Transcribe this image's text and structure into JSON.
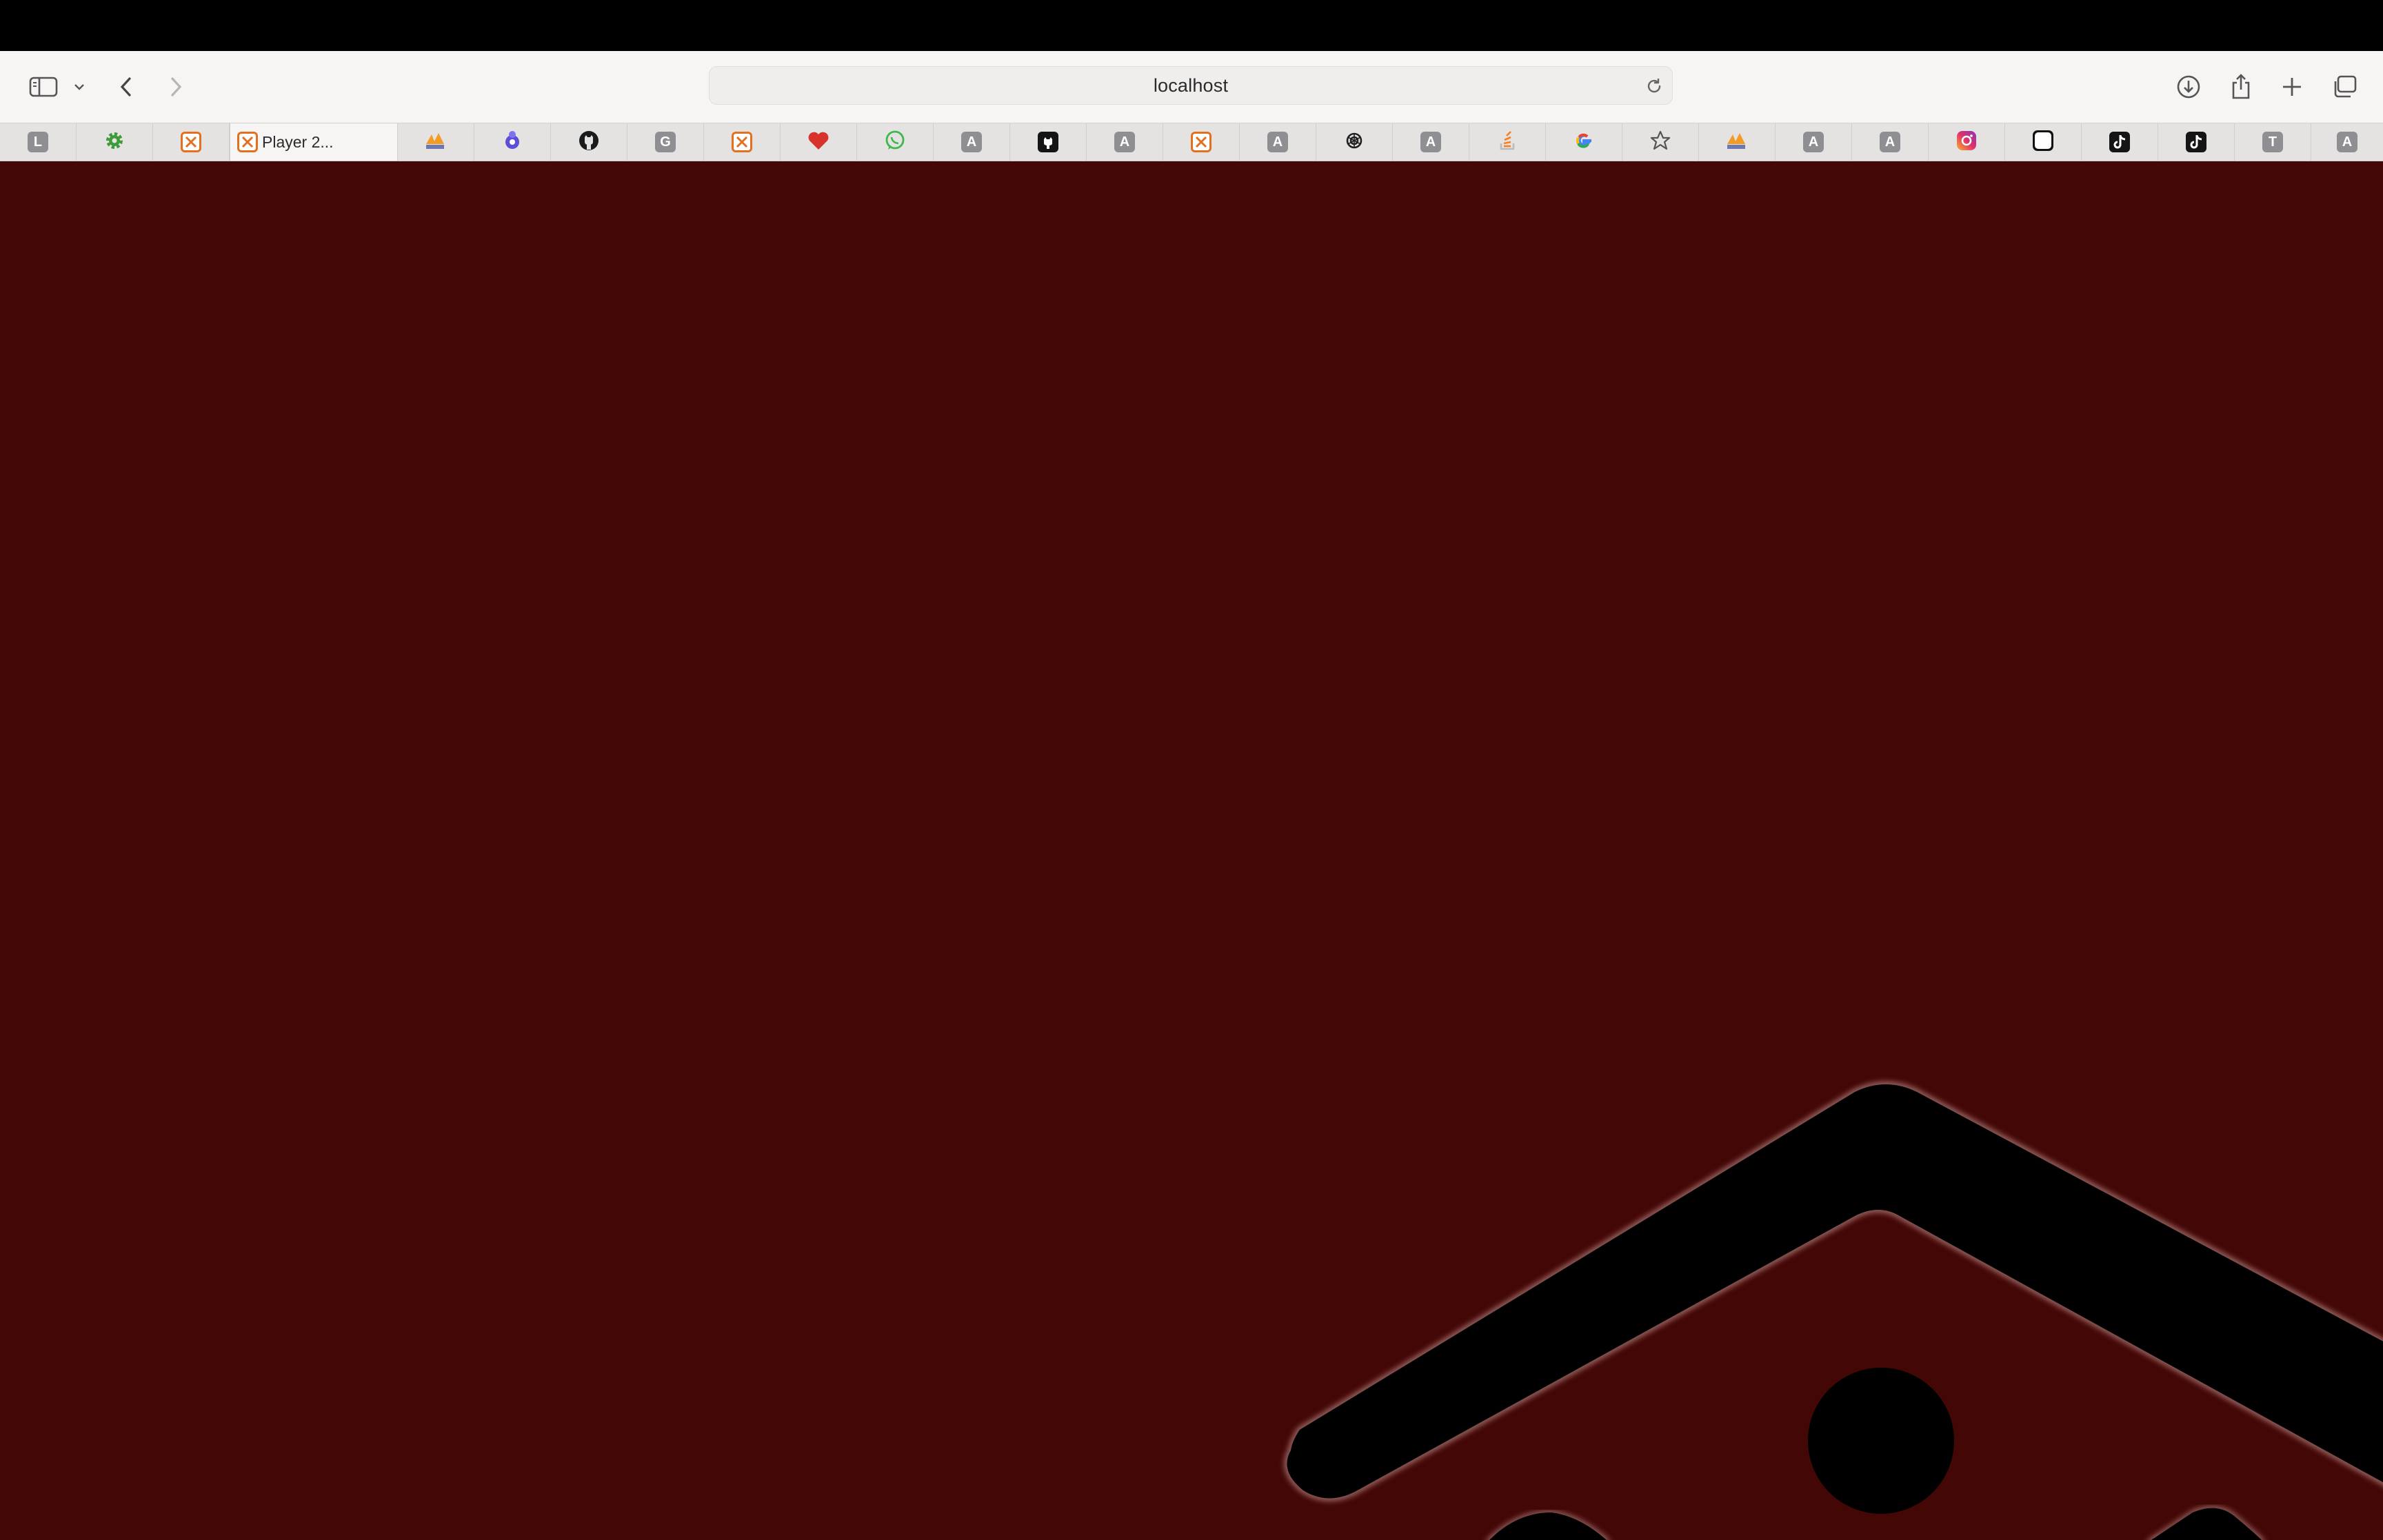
{
  "browser": {
    "address": "localhost",
    "active_tab_title": "Player 2...",
    "tab_letters": {
      "t1": "L",
      "t9": "G",
      "t13": "A",
      "t15": "A",
      "t17": "A",
      "t19": "A",
      "t24": "A",
      "t25": "A",
      "t29": "T",
      "t30": "A"
    },
    "tab_icons": [
      "letter-tab",
      "gear-icon",
      "xampp-icon",
      "xampp-icon",
      "phpmyadmin-icon",
      "blue-app-icon",
      "github-icon",
      "letter-tab",
      "xampp-icon",
      "heart-icon",
      "whatsapp-icon",
      "letter-tab",
      "github-icon",
      "letter-tab",
      "xampp-icon",
      "letter-tab",
      "openai-icon",
      "letter-tab",
      "stackoverflow-icon",
      "google-icon",
      "star-icon",
      "phpmyadmin-icon",
      "letter-tab",
      "letter-tab",
      "instagram-icon",
      "white-square-icon",
      "tiktok-icon",
      "tiktok-icon",
      "letter-tab",
      "letter-tab"
    ]
  },
  "colors": {
    "page_background": "#430706",
    "toolbar": "#f6f5f4",
    "tabbar": "#e4e3e2",
    "xampp_orange": "#e2701f"
  }
}
